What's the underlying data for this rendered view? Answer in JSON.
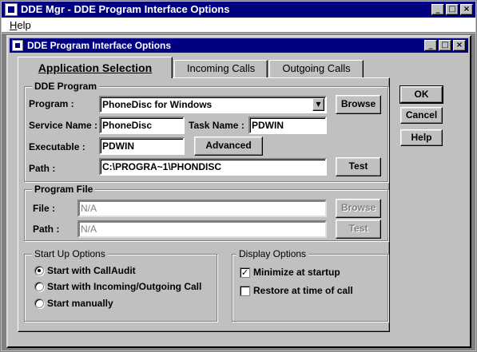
{
  "window": {
    "title": "DDE Mgr - DDE Program Interface Options",
    "controls": [
      "_",
      "□",
      "×"
    ]
  },
  "menu": {
    "items": [
      "Help"
    ]
  },
  "child": {
    "title": "DDE Program Interface Options",
    "controls": [
      "_",
      "□",
      "×"
    ]
  },
  "tabs": [
    {
      "label": "Application Selection",
      "active": true
    },
    {
      "label": "Incoming Calls",
      "active": false
    },
    {
      "label": "Outgoing Calls",
      "active": false
    }
  ],
  "dde_program": {
    "group_label": "DDE Program",
    "program_label": "Program :",
    "program_value": "PhoneDisc for Windows",
    "browse_label": "Browse",
    "service_label": "Service Name :",
    "service_value": "PhoneDisc",
    "task_label": "Task Name :",
    "task_value": "PDWIN",
    "exec_label": "Executable :",
    "exec_value": "PDWIN",
    "advanced_label": "Advanced",
    "path_label": "Path :",
    "path_value": "C:\\PROGRA~1\\PHONDISC",
    "test_label": "Test"
  },
  "program_file": {
    "group_label": "Program File",
    "file_label": "File :",
    "file_value": "N/A",
    "browse_label": "Browse",
    "path_label": "Path :",
    "path_value": "N/A",
    "test_label": "Test"
  },
  "startup": {
    "group_label": "Start Up Options",
    "options": [
      {
        "label": "Start with CallAudit",
        "selected": true
      },
      {
        "label": "Start with Incoming/Outgoing Call",
        "selected": false
      },
      {
        "label": "Start manually",
        "selected": false
      }
    ]
  },
  "display": {
    "group_label": "Display Options",
    "options": [
      {
        "label": "Minimize at startup",
        "checked": true
      },
      {
        "label": "Restore at time of call",
        "checked": false
      }
    ]
  },
  "dialog_buttons": {
    "ok": "OK",
    "cancel": "Cancel",
    "help": "Help"
  }
}
